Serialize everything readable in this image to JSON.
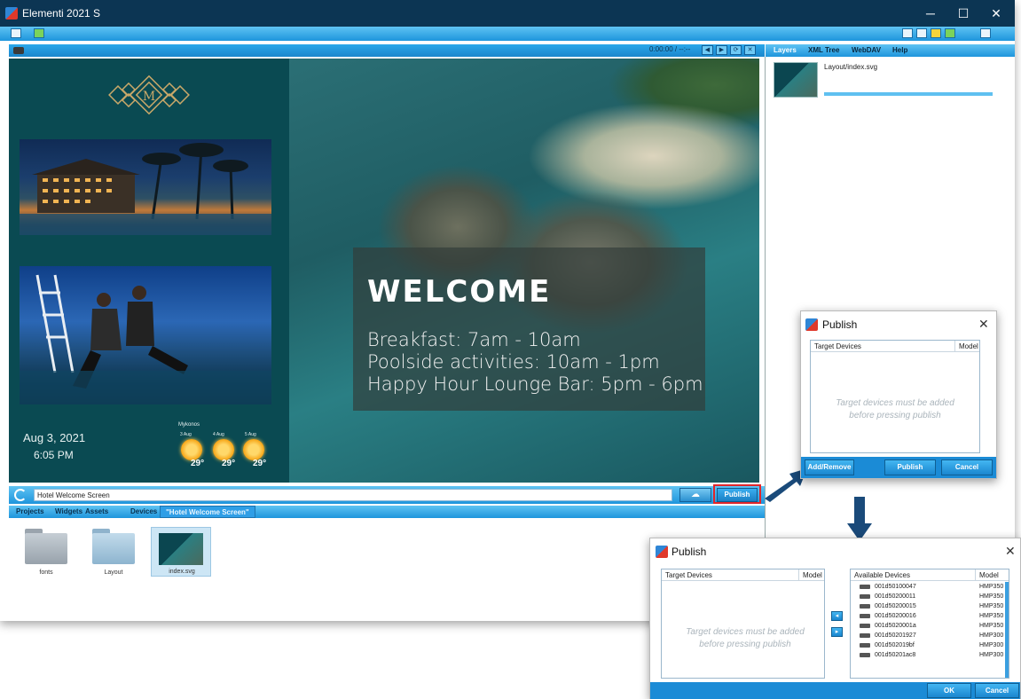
{
  "window": {
    "title": "Elementi 2021 S",
    "controls": {
      "minimize": "─",
      "maximize": "☐",
      "close": "✕"
    }
  },
  "player": {
    "time": "0:00:00 / --:--",
    "buttons": [
      "◀",
      "▶",
      "⟳",
      "✕"
    ]
  },
  "canvas": {
    "date": "Aug 3, 2021",
    "time": "6:05 PM",
    "weather_city": "Mykonos",
    "weather": [
      {
        "day": "3 Aug",
        "temp": "29°"
      },
      {
        "day": "4 Aug",
        "temp": "29°"
      },
      {
        "day": "5 Aug",
        "temp": "29°"
      }
    ],
    "welcome_title": "WELCOME",
    "welcome_lines": [
      "Breakfast: 7am - 10am",
      "Poolside activities: 10am - 1pm",
      "Happy Hour Lounge Bar: 5pm - 6pm"
    ],
    "logo_letter": "M"
  },
  "side_panel": {
    "tabs": [
      "Layers",
      "XML Tree",
      "WebDAV",
      "Help"
    ],
    "active_tab": "Layers",
    "layer_name": "Layout/index.svg"
  },
  "address": {
    "value": "Hotel Welcome Screen",
    "publish_label": "Publish",
    "cloud_icon": "☁"
  },
  "tabs": [
    "Projects",
    "Widgets",
    "Assets",
    "Devices",
    "\"Hotel Welcome Screen\""
  ],
  "files": [
    {
      "name": "fonts",
      "type": "folder"
    },
    {
      "name": "Layout",
      "type": "folder"
    },
    {
      "name": "index.svg",
      "type": "file"
    }
  ],
  "dialog_small": {
    "title": "Publish",
    "close": "✕",
    "col_target": "Target Devices",
    "col_model": "Model",
    "empty_msg": "Target devices must be added before pressing publish",
    "buttons": {
      "add_remove": "Add/Remove",
      "publish": "Publish",
      "cancel": "Cancel"
    }
  },
  "dialog_large": {
    "title": "Publish",
    "close": "✕",
    "target_col": "Target Devices",
    "target_model_col": "Model",
    "available_col": "Available Devices",
    "available_model_col": "Model",
    "empty_msg": "Target devices must be added before pressing publish",
    "devices": [
      {
        "id": "001d50100047",
        "model": "HMP350"
      },
      {
        "id": "001d50200011",
        "model": "HMP350"
      },
      {
        "id": "001d50200015",
        "model": "HMP350"
      },
      {
        "id": "001d50200016",
        "model": "HMP350"
      },
      {
        "id": "001d5020001a",
        "model": "HMP350"
      },
      {
        "id": "001d50201927",
        "model": "HMP300"
      },
      {
        "id": "001d502019bf",
        "model": "HMP300"
      },
      {
        "id": "001d50201ac8",
        "model": "HMP300"
      }
    ],
    "arrow_add": "◂",
    "arrow_remove": "▸",
    "buttons": {
      "ok": "OK",
      "cancel": "Cancel"
    }
  },
  "colors": {
    "titlebar": "#0c3553",
    "accent": "#1e95dc",
    "highlight": "#e1262b",
    "arrow": "#1a4a7a"
  }
}
